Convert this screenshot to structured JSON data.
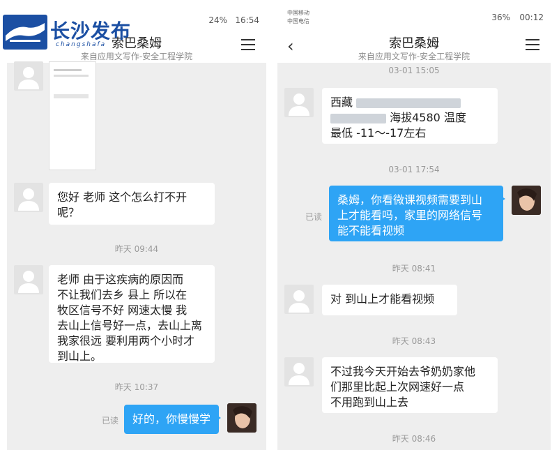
{
  "left": {
    "statusbar": {
      "battery": "24%",
      "time": "16:54"
    },
    "header": {
      "title": "索巴桑姆",
      "subtitle": "来自应用文写作-安全工程学院"
    },
    "logo": {
      "text": "长沙发布",
      "sub": "changshafa"
    },
    "messages": [
      {
        "type": "incoming",
        "text_lines": [
          "您好 老师 这个怎么打不开",
          "呢？"
        ]
      },
      {
        "type": "time",
        "text": "昨天 09:44"
      },
      {
        "type": "incoming",
        "text_lines": [
          "老师 由于这疾病的原因而",
          "不让我们去乡 县上 所以在",
          "牧区信号不好 网速太慢 我",
          "去山上信号好一点，去山上离",
          "我家很远 要利用两个小时才",
          "到山上。"
        ]
      },
      {
        "type": "time",
        "text": "昨天 10:37"
      },
      {
        "type": "outgoing",
        "read": "已读",
        "text": "好的，你慢慢学"
      }
    ]
  },
  "right": {
    "statusbar": {
      "carrier1": "中国移动",
      "carrier2": "中国电信",
      "battery": "36%",
      "time": "00:12"
    },
    "header": {
      "title": "索巴桑姆",
      "subtitle": "来自应用文写作-安全工程学院"
    },
    "messages": [
      {
        "type": "time",
        "text": "03-01 15:05"
      },
      {
        "type": "incoming",
        "line1": "西藏",
        "line2": "海拔4580 温度",
        "line3": "最低 -11～-17左右"
      },
      {
        "type": "time",
        "text": "03-01 17:54"
      },
      {
        "type": "outgoing",
        "read": "已读",
        "text_lines": [
          "桑姆，你看微课视频需要到山",
          "上才能看吗，家里的网络信号",
          "能不能看视频"
        ]
      },
      {
        "type": "time",
        "text": "昨天 08:41"
      },
      {
        "type": "incoming",
        "text": "对 到山上才能看视频"
      },
      {
        "type": "time",
        "text": "昨天 08:43"
      },
      {
        "type": "incoming",
        "text_lines": [
          "不过我今天开始去爷奶奶家他",
          "们那里比起上次网速好一点",
          "不用跑到山上去"
        ]
      },
      {
        "type": "time",
        "text": "昨天 08:46"
      }
    ]
  },
  "colors": {
    "blue_bubble": "#2ea4f5",
    "logo_blue": "#1b4fa3"
  }
}
